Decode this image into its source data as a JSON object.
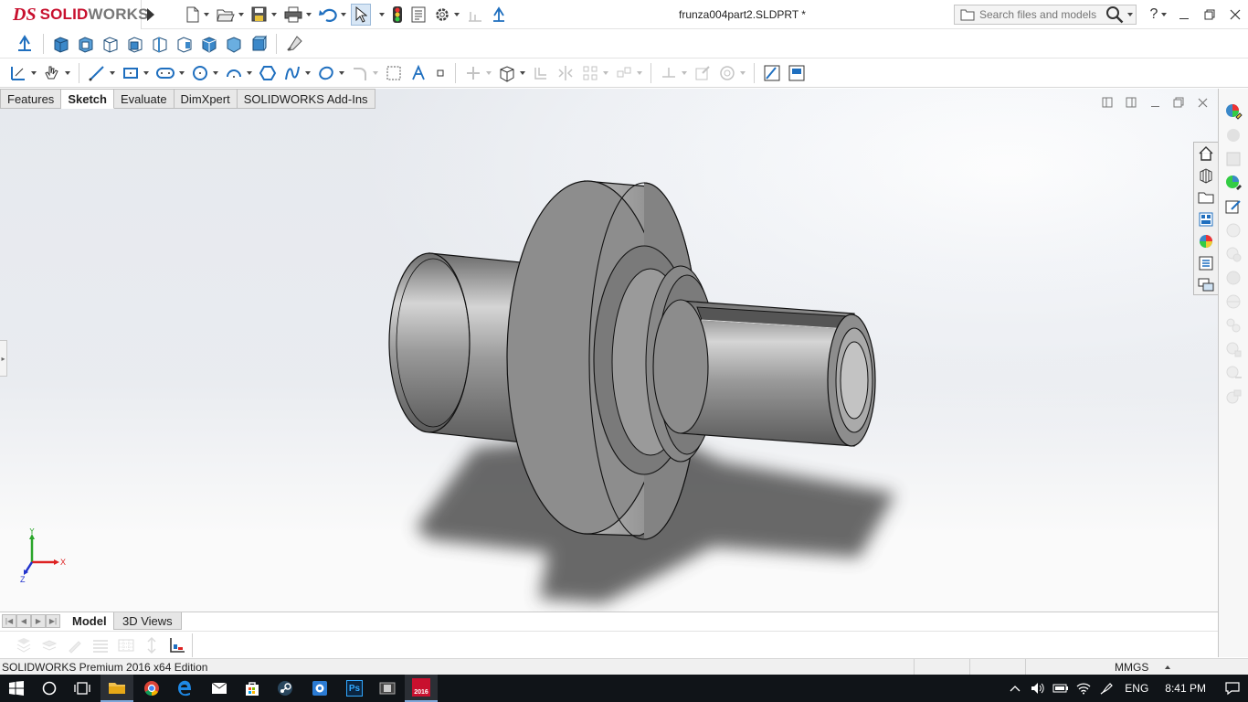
{
  "app": {
    "brand_ds": "DS",
    "brand_solid": "SOLID",
    "brand_works": "WORKS",
    "doc_title": "frunza004part2.SLDPRT *",
    "search_placeholder": "Search files and models",
    "help_label": "?"
  },
  "colors": {
    "brand_red": "#c8102e",
    "accent_blue": "#1f6fbf",
    "viewport_light": "#ffffff",
    "viewport_gray": "#e6e9ee",
    "part_gray": "#8a8a8a",
    "taskbar": "#101418"
  },
  "quick_access": [
    {
      "icon": "new-document-icon"
    },
    {
      "icon": "open-folder-icon"
    },
    {
      "icon": "save-icon"
    },
    {
      "icon": "print-icon"
    },
    {
      "icon": "undo-icon"
    },
    {
      "icon": "select-arrow-icon"
    },
    {
      "icon": "rebuild-traffic-light-icon"
    },
    {
      "icon": "file-properties-icon"
    },
    {
      "icon": "options-gear-icon"
    }
  ],
  "command_tabs": [
    {
      "label": "Features",
      "active": false
    },
    {
      "label": "Sketch",
      "active": true
    },
    {
      "label": "Evaluate",
      "active": false
    },
    {
      "label": "DimXpert",
      "active": false
    },
    {
      "label": "SOLIDWORKS Add-Ins",
      "active": false
    }
  ],
  "bottom_tabs": {
    "model": "Model",
    "views3d": "3D Views"
  },
  "triad": {
    "x": "X",
    "y": "Y",
    "z": "Z"
  },
  "status": {
    "edition": "SOLIDWORKS Premium 2016 x64 Edition",
    "units": "MMGS"
  },
  "taskbar": {
    "solidworks_badge": "2016",
    "photoshop_label": "Ps",
    "language": "ENG",
    "time": "8:41 PM"
  }
}
